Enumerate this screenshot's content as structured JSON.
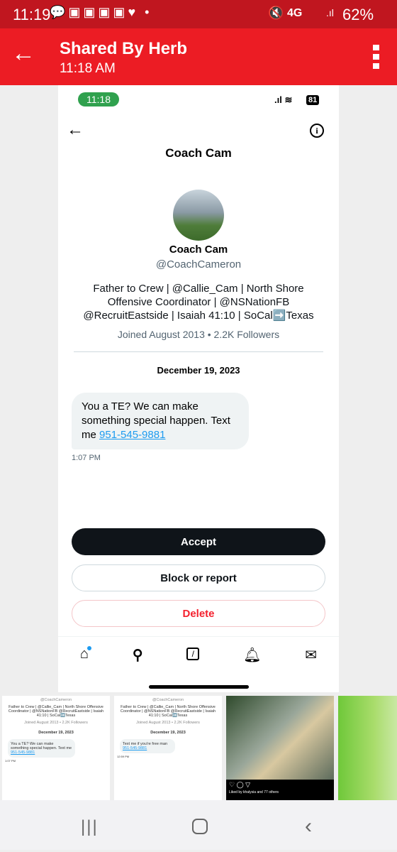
{
  "status_bar": {
    "time": "11:19",
    "network": "4G",
    "battery": "62%"
  },
  "app_bar": {
    "title": "Shared By Herb",
    "subtitle": "11:18 AM"
  },
  "shared_screenshot": {
    "status": {
      "time": "11:18",
      "battery": "81"
    },
    "header_title": "Coach Cam",
    "profile": {
      "name": "Coach Cam",
      "handle": "@CoachCameron",
      "bio_lines": [
        "Father to Crew | @Callie_Cam | North Shore",
        "Offensive Coordinator | @NSNationFB",
        "@RecruitEastside | Isaiah 41:10 | SoCal➡️Texas"
      ],
      "joined": "Joined August 2013 • 2.2K Followers"
    },
    "date": "December 19, 2023",
    "message": {
      "text": "You a TE? We can make something special happen. Text me ",
      "phone": "951-545-9881",
      "time": "1:07 PM"
    },
    "buttons": {
      "accept": "Accept",
      "block": "Block or report",
      "delete": "Delete"
    },
    "tabs": [
      "home-icon",
      "search-icon",
      "compose-icon",
      "bell-icon",
      "mail-icon"
    ]
  },
  "thumbnails": [
    {
      "handle": "@CoachCameron",
      "bio": "Father to Crew | @Callie_Cam | North Shore Offensive Coordinator | @NSNationFB @RecruitEastside | Isaiah 41:10 | SoCal➡️Texas",
      "joined": "Joined August 2013 • 2.2K Followers",
      "date": "December 19, 2023",
      "msg": "You a TE? We can make something special happen. Text me ",
      "phone": "951-545-9881",
      "time": "1:07 PM"
    },
    {
      "handle": "@CoachCameron",
      "bio": "Father to Crew | @Callie_Cam | North Shore Offensive Coordinator | @NSNationFB @RecruitEastside | Isaiah 41:10 | SoCal➡️Texas",
      "joined": "Joined August 2013 • 2.2K Followers",
      "date": "December 19, 2023",
      "msg": "Text me if you're free man ",
      "phone": "951-545-9881",
      "time": "12:59 PM"
    },
    {
      "likes": "Liked by khalysia and 77 others"
    }
  ],
  "colors": {
    "status_bar": "#c0161f",
    "app_bar": "#ec1c24",
    "accept": "#0f1419",
    "delete": "#f4212e",
    "link": "#1d9bf0"
  }
}
